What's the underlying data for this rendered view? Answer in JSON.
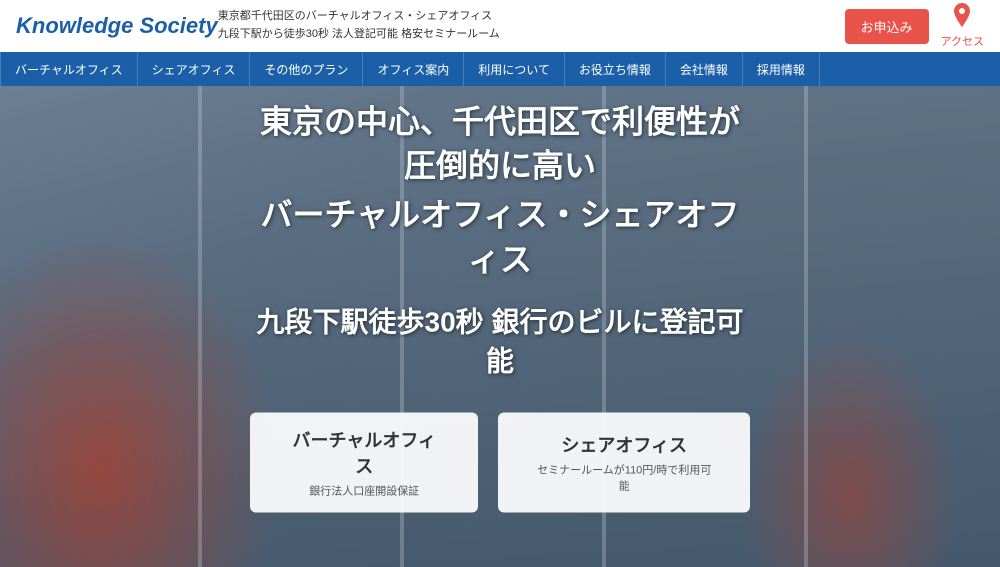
{
  "header": {
    "logo": "Knowledge Society",
    "tagline_line1": "東京都千代田区のバーチャルオフィス・シェアオフィス",
    "tagline_line2": "九段下駅から徒歩30秒 法人登記可能 格安セミナールーム",
    "apply_button": "お申込み",
    "access_button": "アクセス"
  },
  "nav": {
    "items": [
      "バーチャルオフィス",
      "シェアオフィス",
      "その他のプラン",
      "オフィス案内",
      "利用について",
      "お役立ち情報",
      "会社情報",
      "採用情報"
    ]
  },
  "hero": {
    "title_line1": "東京の中心、千代田区で利便性が圧倒的に高い",
    "title_line2": "バーチャルオフィス・シェアオフィス",
    "title_line3": "九段下駅徒歩30秒 銀行のビルに登記可能",
    "btn_virtual_label": "バーチャルオフィス",
    "btn_virtual_sub": "銀行法人口座開設保証",
    "btn_share_label": "シェアオフィス",
    "btn_share_sub": "セミナールームが110円/時で利用可能"
  }
}
